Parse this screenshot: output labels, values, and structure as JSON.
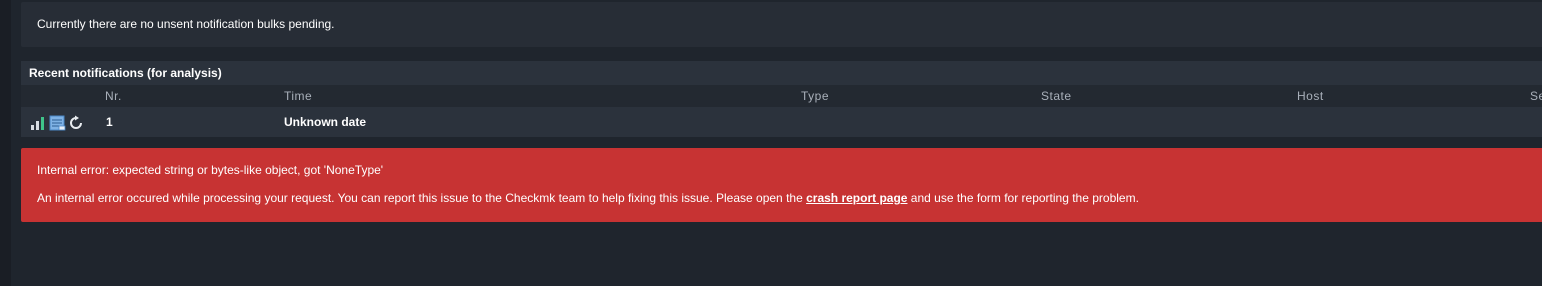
{
  "info": {
    "message": "Currently there are no unsent notification bulks pending."
  },
  "notifications_table": {
    "title": "Recent notifications (for analysis)",
    "columns": [
      "Nr.",
      "Time",
      "Type",
      "State",
      "Host",
      "Se"
    ],
    "rows": [
      {
        "nr": "1",
        "time": "Unknown date",
        "icons": [
          "analyze-icon",
          "context-icon",
          "replay-icon"
        ]
      }
    ]
  },
  "error": {
    "title": "Internal error: expected string or bytes-like object, got 'NoneType'",
    "message_before": "An internal error occured while processing your request. You can report this issue to the Checkmk team to help fixing this issue. Please open the ",
    "link_text": "crash report page",
    "message_after": " and use the form for reporting the problem."
  },
  "colors": {
    "background": "#1f252d",
    "panel": "#272d36",
    "error": "#c73333",
    "accent_green": "#3fc48a"
  }
}
